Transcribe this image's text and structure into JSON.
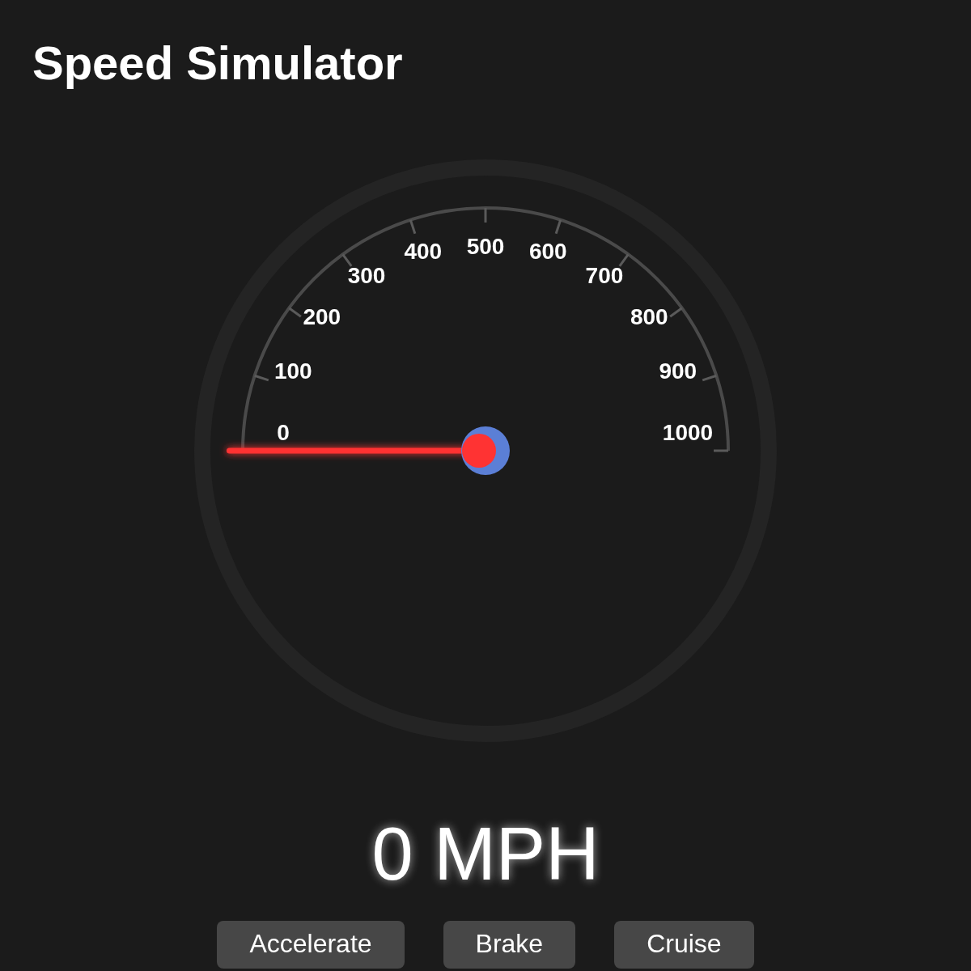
{
  "title": "Speed Simulator",
  "gauge": {
    "scale_labels": [
      "0",
      "100",
      "200",
      "300",
      "400",
      "500",
      "600",
      "700",
      "800",
      "900",
      "1000"
    ]
  },
  "reading": "0 MPH",
  "buttons": [
    "Accelerate",
    "Brake",
    "Cruise"
  ]
}
